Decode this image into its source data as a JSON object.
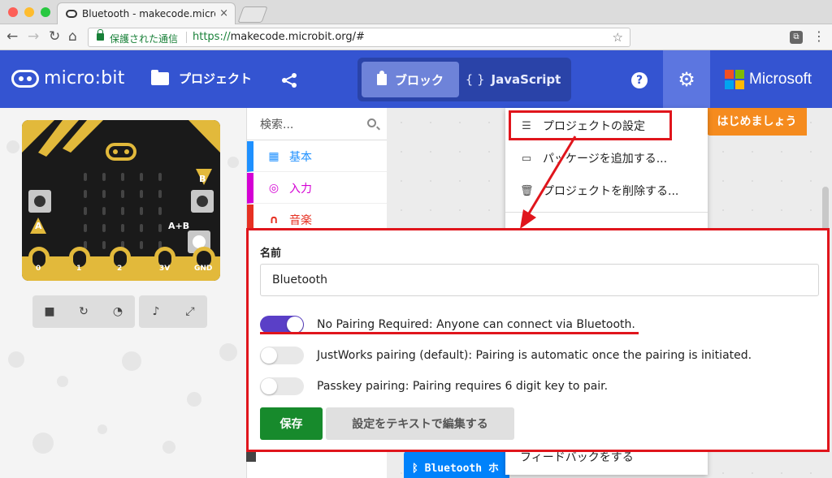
{
  "browser": {
    "tab_title": "Bluetooth - makecode.microbit.org",
    "tab_close": "×",
    "secure_label": "保護された通信",
    "url_scheme": "https://",
    "url_rest": "makecode.microbit.org/#",
    "traffic_colors": [
      "#fd5f57",
      "#febc2e",
      "#28c840"
    ]
  },
  "header": {
    "logo_text": "micro:bit",
    "projects_label": "プロジェクト",
    "blocks_label": "ブロック",
    "javascript_braces": "{ }",
    "javascript_label": "JavaScript",
    "help_symbol": "?",
    "brand_text": "Microsoft",
    "brand_colors": [
      "#f25022",
      "#7fba00",
      "#00a4ef",
      "#ffb900"
    ],
    "accent_color": "#3454d1"
  },
  "simulator": {
    "label_a": "A",
    "label_b": "B",
    "label_ab": "A+B",
    "pins": [
      "0",
      "1",
      "2",
      "3V",
      "GND"
    ],
    "toolbar_icons": [
      "stop-icon",
      "restart-icon",
      "slowmo-icon",
      "sound-icon",
      "fullscreen-icon"
    ]
  },
  "toolbox": {
    "search_placeholder": "検索...",
    "categories": [
      {
        "label": "基本",
        "color": "#1e90ff",
        "icon": "grid-icon"
      },
      {
        "label": "入力",
        "color": "#d400d4",
        "icon": "target-icon"
      },
      {
        "label": "音楽",
        "color": "#e63022",
        "icon": "headphones-icon"
      }
    ]
  },
  "workspace": {
    "get_started_label": "はじめましょう",
    "block_label": "Bluetooth ホ"
  },
  "settings_menu": {
    "items": [
      {
        "label": "プロジェクトの設定",
        "icon": "sliders-icon"
      },
      {
        "label": "パッケージを追加する...",
        "icon": "drive-icon"
      },
      {
        "label": "プロジェクトを削除する...",
        "icon": "trash-icon"
      }
    ],
    "feedback_label": "フィードバックをする"
  },
  "dialog": {
    "name_label": "名前",
    "name_value": "Bluetooth",
    "options": [
      {
        "label": "No Pairing Required: Anyone can connect via Bluetooth.",
        "on": true
      },
      {
        "label": "JustWorks pairing (default): Pairing is automatic once the pairing is initiated.",
        "on": false
      },
      {
        "label": "Passkey pairing: Pairing requires 6 digit key to pair.",
        "on": false
      }
    ],
    "save_label": "保存",
    "edit_label": "設定をテキストで編集する",
    "toggle_on_color": "#5a3fc7",
    "highlight_color": "#e0151c"
  }
}
